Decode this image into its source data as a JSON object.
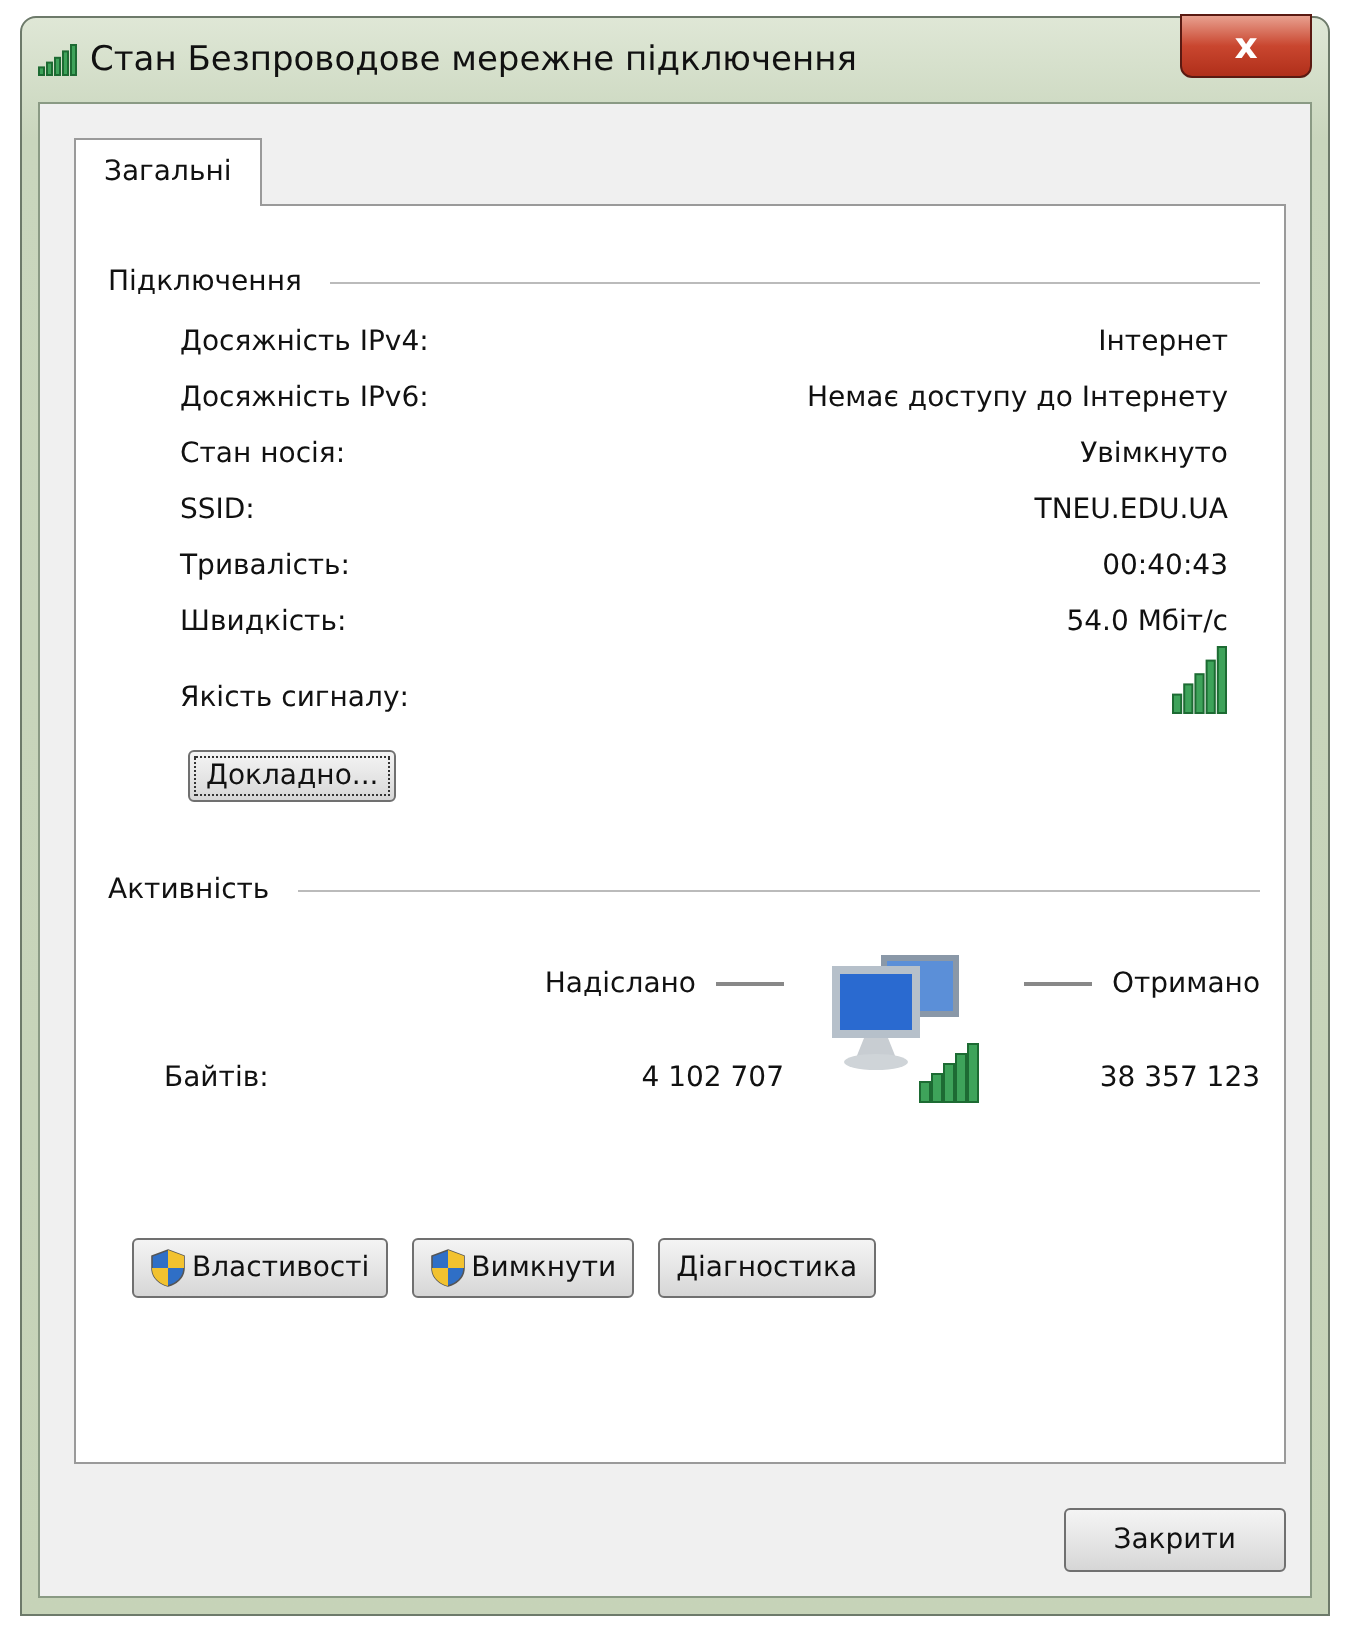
{
  "window": {
    "title": "Стан Безпроводове мережне підключення",
    "close_glyph": "x"
  },
  "tabs": [
    {
      "label": "Загальні",
      "selected": true
    }
  ],
  "connection": {
    "heading": "Підключення",
    "rows": [
      {
        "label": "Досяжність IPv4:",
        "value": "Інтернет"
      },
      {
        "label": "Досяжність IPv6:",
        "value": "Немає доступу до Інтернету"
      },
      {
        "label": "Стан носія:",
        "value": "Увімкнуто"
      },
      {
        "label": "SSID:",
        "value": "TNEU.EDU.UA"
      },
      {
        "label": "Тривалість:",
        "value": "00:40:43"
      },
      {
        "label": "Швидкість:",
        "value": "54.0 Мбіт/с"
      }
    ],
    "signal_label": "Якість сигналу:",
    "details_button": {
      "label": "Докладно..."
    }
  },
  "activity": {
    "heading": "Активність",
    "sent_label": "Надіслано",
    "received_label": "Отримано",
    "bytes_label": "Байтів:",
    "sent": "4 102 707",
    "received": "38 357 123"
  },
  "buttons": [
    {
      "label": "Властивості",
      "shield": true
    },
    {
      "label": "Вимкнути",
      "shield": true
    },
    {
      "label": "Діагностика",
      "shield": false
    }
  ],
  "close_button": {
    "label": "Закрити"
  }
}
